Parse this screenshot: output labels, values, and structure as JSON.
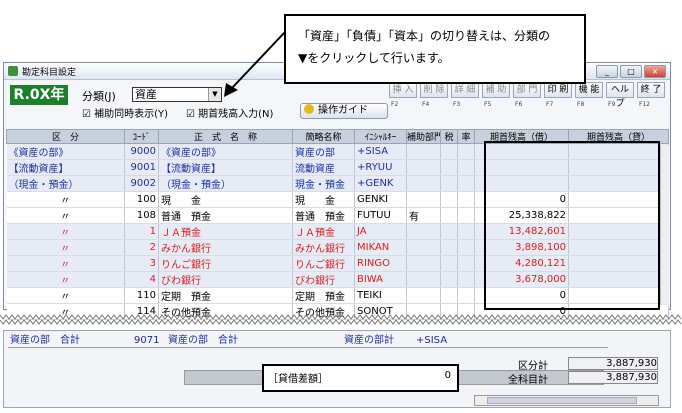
{
  "callout": {
    "line1": "「資産」「負債」「資本」の切り替えは、分類の",
    "line2": "▼をクリックして行います。"
  },
  "window": {
    "title": "勘定科目設定",
    "buttons": [
      "_",
      "□",
      "×"
    ]
  },
  "era_badge": "R.0X年",
  "category": {
    "label": "分類(J)",
    "value": "資産",
    "dropdown_glyph": "▼"
  },
  "checkboxes": [
    {
      "label": "補助同時表示(Y)",
      "checked": true
    },
    {
      "label": "期首残高入力(N)",
      "checked": true
    }
  ],
  "guide_button": "操作ガイド",
  "fkeys": [
    {
      "label": "挿 入",
      "num": "F2",
      "enabled": false
    },
    {
      "label": "削 除",
      "num": "F4",
      "enabled": false
    },
    {
      "label": "詳 細",
      "num": "F3",
      "enabled": false
    },
    {
      "label": "補 助",
      "num": "F5",
      "enabled": false
    },
    {
      "label": "部 門",
      "num": "F6",
      "enabled": false
    },
    {
      "label": "印 刷",
      "num": "F7",
      "enabled": true
    },
    {
      "label": "機 能",
      "num": "F8",
      "enabled": true
    },
    {
      "label": "ヘルプ",
      "num": "F9",
      "enabled": true
    },
    {
      "label": "終 了",
      "num": "F12",
      "enabled": true
    }
  ],
  "columns": [
    "区　分",
    "ｺｰﾄﾞ",
    "正　式　名　称",
    "簡略名称",
    "ｲﾆｼｬﾙｷｰ",
    "補助部門",
    "税",
    "率",
    "期首残高（借）",
    "期首残高（貸）"
  ],
  "rows": [
    {
      "kubun": "《資産の部》",
      "code": "9000",
      "name": "《資産の部》",
      "short": "資産の部",
      "initial": "+SISA",
      "hojo": "",
      "debit": "",
      "credit": "",
      "style": "blue",
      "bg": "b"
    },
    {
      "kubun": "【流動資産】",
      "code": "9001",
      "name": "【流動資産】",
      "short": "流動資産",
      "initial": "+RYUU",
      "hojo": "",
      "debit": "",
      "credit": "",
      "style": "blue",
      "bg": "b"
    },
    {
      "kubun": "（現金・預金）",
      "code": "9002",
      "name": "（現金・預金）",
      "short": "現金・預金",
      "initial": "+GENK",
      "hojo": "",
      "debit": "",
      "credit": "",
      "style": "blue",
      "bg": "b"
    },
    {
      "kubun": "〃",
      "code": "100",
      "name": "現　　金",
      "short": "現　　金",
      "initial": "GENKI",
      "hojo": "",
      "debit": "0",
      "credit": "",
      "style": "",
      "bg": "w"
    },
    {
      "kubun": "〃",
      "code": "108",
      "name": "普通　預金",
      "short": "普通　預金",
      "initial": "FUTUU",
      "hojo": "有",
      "debit": "25,338,822",
      "credit": "",
      "style": "",
      "bg": "w"
    },
    {
      "kubun": "〃",
      "code": "1",
      "name": "ＪＡ預金",
      "short": "ＪＡ預金",
      "initial": "JA",
      "hojo": "",
      "debit": "13,482,601",
      "credit": "",
      "style": "red",
      "bg": "b"
    },
    {
      "kubun": "〃",
      "code": "2",
      "name": "みかん銀行",
      "short": "みかん銀行",
      "initial": "MIKAN",
      "hojo": "",
      "debit": "3,898,100",
      "credit": "",
      "style": "red",
      "bg": "b"
    },
    {
      "kubun": "〃",
      "code": "3",
      "name": "りんご銀行",
      "short": "りんご銀行",
      "initial": "RINGO",
      "hojo": "",
      "debit": "4,280,121",
      "credit": "",
      "style": "red",
      "bg": "b"
    },
    {
      "kubun": "〃",
      "code": "4",
      "name": "びわ銀行",
      "short": "びわ銀行",
      "initial": "BIWA",
      "hojo": "",
      "debit": "3,678,000",
      "credit": "",
      "style": "red",
      "bg": "b"
    },
    {
      "kubun": "〃",
      "code": "110",
      "name": "定期　預金",
      "short": "定期　預金",
      "initial": "TEIKI",
      "hojo": "",
      "debit": "0",
      "credit": "",
      "style": "",
      "bg": "w"
    },
    {
      "kubun": "〃",
      "code": "114",
      "name": "その他預金",
      "short": "その他預金",
      "initial": "SONOT",
      "hojo": "",
      "debit": "0",
      "credit": "",
      "style": "",
      "bg": "w"
    }
  ],
  "total_row": {
    "kubun": "資産の部　合計",
    "code": "9071",
    "name": "資産の部　合計",
    "short": "資産の部計",
    "initial": "+SISA"
  },
  "difference": {
    "label": "［貸借差額］",
    "value": "0"
  },
  "summaries": [
    {
      "label": "区分計",
      "value": "3,887,930"
    },
    {
      "label": "全科目計",
      "value": "3,887,930"
    }
  ]
}
